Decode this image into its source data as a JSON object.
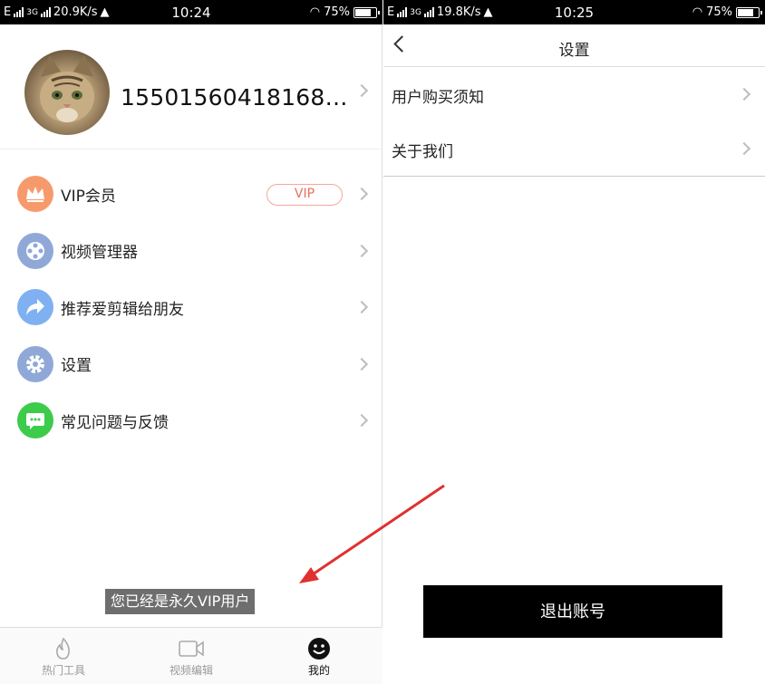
{
  "left_screen": {
    "status": {
      "network": "E",
      "gen": "3G",
      "speed": "20.9K/s",
      "time": "10:24",
      "battery": "75%",
      "battery_level": 0.75
    },
    "profile": {
      "phone": "15501560418168…"
    },
    "menu": [
      {
        "label": "VIP会员",
        "icon": "crown-icon",
        "color": "#f79a6b",
        "badge": "VIP"
      },
      {
        "label": "视频管理器",
        "icon": "film-reel-icon",
        "color": "#8fa8d8"
      },
      {
        "label": "推荐爱剪辑给朋友",
        "icon": "share-arrow-icon",
        "color": "#7fb0f2"
      },
      {
        "label": "设置",
        "icon": "gear-icon",
        "color": "#8fa8d8"
      },
      {
        "label": "常见问题与反馈",
        "icon": "chat-bubble-icon",
        "color": "#3ccb4a"
      }
    ],
    "toast": "您已经是永久VIP用户",
    "tabs": [
      {
        "label": "热门工具",
        "icon": "flame-icon",
        "active": false
      },
      {
        "label": "视频编辑",
        "icon": "video-camera-icon",
        "active": false
      },
      {
        "label": "我的",
        "icon": "smiley-face-icon",
        "active": true
      }
    ]
  },
  "right_screen": {
    "status": {
      "network": "E",
      "gen": "3G",
      "speed": "19.8K/s",
      "time": "10:25",
      "battery": "75%",
      "battery_level": 0.75
    },
    "nav": {
      "title": "设置"
    },
    "settings": [
      {
        "label": "用户购买须知"
      },
      {
        "label": "关于我们"
      }
    ],
    "logout_label": "退出账号"
  },
  "colors": {
    "annotation_arrow": "#e03030",
    "vip_badge": "#e8705c",
    "logout_bg": "#000000"
  }
}
